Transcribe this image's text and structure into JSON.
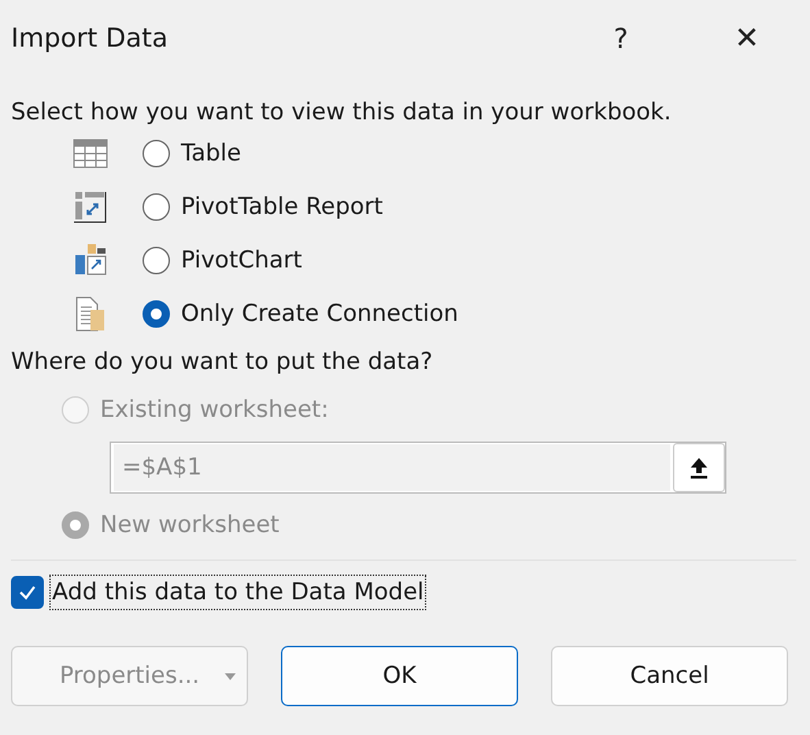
{
  "window": {
    "title": "Import Data",
    "help": "?",
    "close": "✕"
  },
  "view": {
    "prompt": "Select how you want to view this data in your workbook.",
    "options": [
      {
        "label": "Table",
        "kind": "table",
        "selected": false
      },
      {
        "label": "PivotTable Report",
        "kind": "pivottable",
        "selected": false
      },
      {
        "label": "PivotChart",
        "kind": "pivotchart",
        "selected": false
      },
      {
        "label": "Only Create Connection",
        "kind": "connection",
        "selected": true
      }
    ]
  },
  "destination": {
    "prompt": "Where do you want to put the data?",
    "disabled": true,
    "options": [
      {
        "label": "Existing worksheet:",
        "selected": false
      },
      {
        "label": "New worksheet",
        "selected": true
      }
    ],
    "range": "=$A$1"
  },
  "data_model": {
    "label": "Add this data to the Data Model",
    "checked": true
  },
  "buttons": [
    {
      "label": "Properties...",
      "kind": "dropdown",
      "disabled": true
    },
    {
      "label": "OK",
      "kind": "default",
      "disabled": false
    },
    {
      "label": "Cancel",
      "kind": "plain",
      "disabled": false
    }
  ]
}
